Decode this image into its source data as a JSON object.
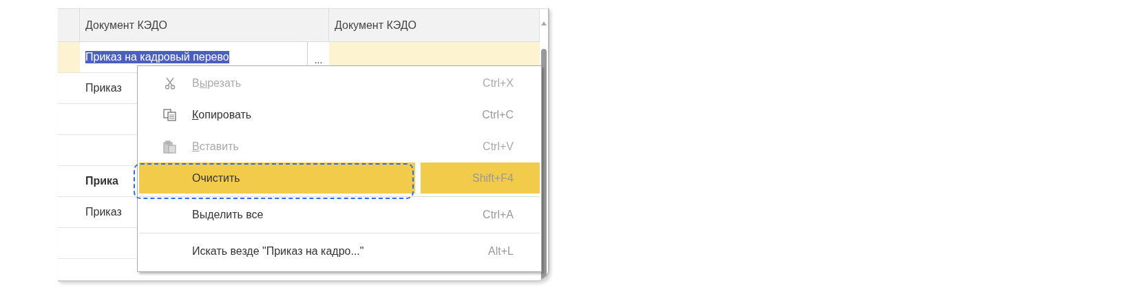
{
  "table": {
    "columns": [
      {
        "title": "Документ КЭДО"
      },
      {
        "title": "Документ КЭДО"
      }
    ],
    "rows": [
      {
        "selected": true,
        "cell": "Приказ на кадровый перево",
        "text_selected": true,
        "button": "..."
      },
      {
        "selected": false,
        "cell": "Приказ"
      },
      {
        "selected": false
      },
      {
        "selected": false
      },
      {
        "selected": false,
        "cell": "Прика",
        "bold": true
      },
      {
        "selected": false,
        "cell": "Приказ"
      },
      {
        "selected": false
      }
    ]
  },
  "context_menu": {
    "items": [
      {
        "kind": "cut",
        "before": "В",
        "access_key": "ы",
        "after": "резать",
        "shortcut": "Ctrl+X",
        "disabled": true,
        "selected": false,
        "separator_after": false
      },
      {
        "kind": "copy",
        "access_key": "К",
        "after": "опировать",
        "shortcut": "Ctrl+C",
        "disabled": false,
        "selected": false,
        "separator_after": false
      },
      {
        "kind": "paste",
        "access_key": "В",
        "after": "ставить",
        "shortcut": "Ctrl+V",
        "disabled": true,
        "selected": false,
        "separator_after": false
      },
      {
        "kind": "plain",
        "before": "Очистить",
        "shortcut": "Shift+F4",
        "disabled": false,
        "selected": true,
        "separator_after": true
      },
      {
        "kind": "plain",
        "before": "Выделить все",
        "shortcut": "Ctrl+A",
        "disabled": false,
        "selected": false,
        "separator_after": true
      },
      {
        "kind": "plain",
        "before": "Искать везде \"Приказ на кадро...\"",
        "shortcut": "Alt+L",
        "disabled": false,
        "selected": false,
        "separator_after": false
      }
    ]
  }
}
